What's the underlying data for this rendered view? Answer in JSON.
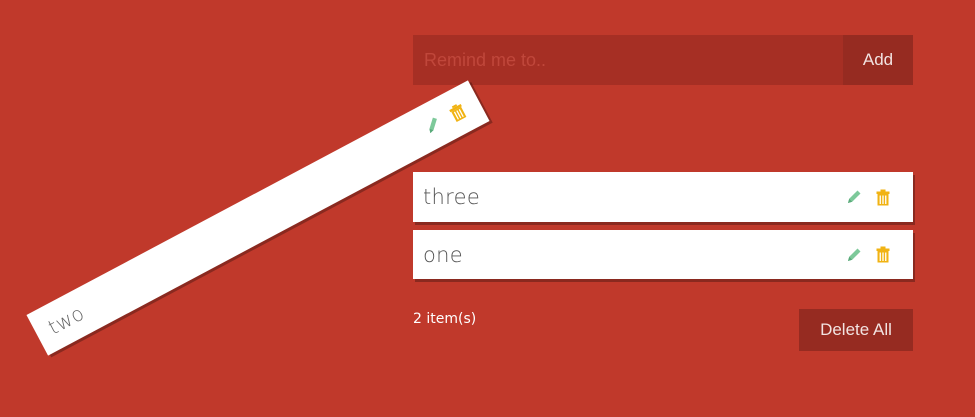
{
  "input": {
    "placeholder": "Remind me to..",
    "value": ""
  },
  "add_button_label": "Add",
  "todos": [
    {
      "text": "three"
    },
    {
      "text": "one"
    },
    {
      "text": "two"
    }
  ],
  "footer": {
    "count_label": "2 item(s)",
    "delete_all_label": "Delete All"
  },
  "colors": {
    "background": "#c0392b",
    "input_background": "#a62f24",
    "button_background": "#962b21",
    "edit_icon": "#7dc99a",
    "delete_icon": "#f1b313"
  },
  "icons": {
    "edit": "pencil-icon",
    "delete": "trash-icon"
  }
}
